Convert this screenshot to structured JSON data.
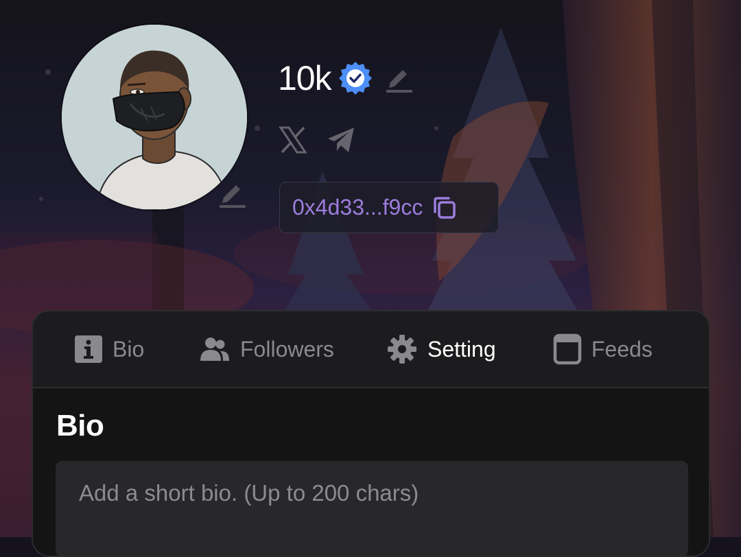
{
  "profile": {
    "username": "10k",
    "verified": true,
    "address": "0x4d33...f9cc"
  },
  "socials": [
    {
      "icon": "x-logo-icon"
    },
    {
      "icon": "telegram-icon"
    }
  ],
  "tabs": [
    {
      "label": "Bio",
      "icon": "info-icon",
      "active": false
    },
    {
      "label": "Followers",
      "icon": "users-icon",
      "active": false
    },
    {
      "label": "Setting",
      "icon": "gear-icon",
      "active": true
    },
    {
      "label": "Feeds",
      "icon": "window-icon",
      "active": false
    }
  ],
  "bio": {
    "title": "Bio",
    "placeholder": "Add a short bio. (Up to 200 chars)",
    "value": ""
  },
  "colors": {
    "accent": "#9d7ddc",
    "verified": "#4d8ef7",
    "panel_bg": "#141414",
    "tab_bar_bg": "#1c1c1e",
    "input_bg": "#28282b"
  }
}
